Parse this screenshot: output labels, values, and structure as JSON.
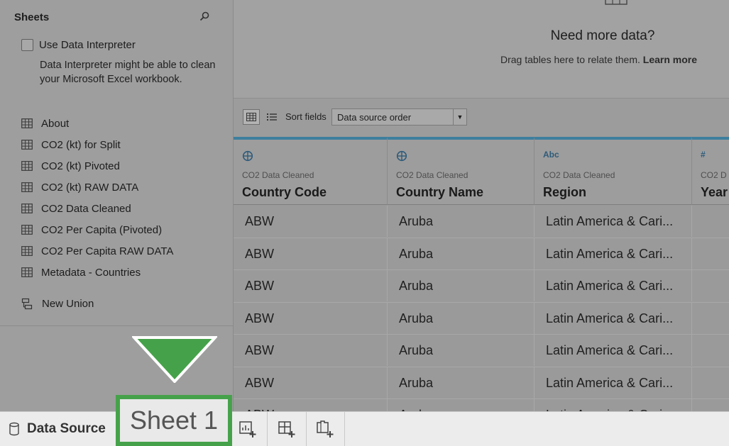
{
  "sidebar": {
    "title": "Sheets",
    "search_icon": "search-icon",
    "interpreter": {
      "label": "Use Data Interpreter",
      "checked": false,
      "description": "Data Interpreter might be able to clean your Microsoft Excel workbook."
    },
    "sheets": [
      {
        "label": "About"
      },
      {
        "label": "CO2 (kt) for Split"
      },
      {
        "label": "CO2 (kt) Pivoted"
      },
      {
        "label": "CO2 (kt) RAW DATA"
      },
      {
        "label": "CO2 Data Cleaned"
      },
      {
        "label": "CO2 Per Capita (Pivoted)"
      },
      {
        "label": "CO2 Per Capita RAW DATA"
      },
      {
        "label": "Metadata - Countries"
      }
    ],
    "new_union": "New Union"
  },
  "canvas": {
    "heading": "Need more data?",
    "hint": "Drag tables here to relate them.",
    "learn_more": "Learn more"
  },
  "toolbar": {
    "sort_label": "Sort fields",
    "sort_value": "Data source order"
  },
  "grid": {
    "columns": [
      {
        "type_icon": "globe-icon",
        "type_text": "",
        "source": "CO2 Data Cleaned",
        "name": "Country Code"
      },
      {
        "type_icon": "globe-icon",
        "type_text": "",
        "source": "CO2 Data Cleaned",
        "name": "Country Name"
      },
      {
        "type_icon": "",
        "type_text": "Abc",
        "source": "CO2 Data Cleaned",
        "name": "Region"
      },
      {
        "type_icon": "",
        "type_text": "#",
        "source": "CO2 D",
        "name": "Year"
      }
    ],
    "rows": [
      [
        "ABW",
        "Aruba",
        "Latin America & Cari..."
      ],
      [
        "ABW",
        "Aruba",
        "Latin America & Cari..."
      ],
      [
        "ABW",
        "Aruba",
        "Latin America & Cari..."
      ],
      [
        "ABW",
        "Aruba",
        "Latin America & Cari..."
      ],
      [
        "ABW",
        "Aruba",
        "Latin America & Cari..."
      ],
      [
        "ABW",
        "Aruba",
        "Latin America & Cari..."
      ],
      [
        "ABW",
        "Aruba",
        "Latin America & Cari..."
      ]
    ]
  },
  "tabs": {
    "data_source": "Data Source",
    "sheet1": "Sheet 1"
  },
  "colors": {
    "highlight": "#46a24a",
    "column_accent": "#3e7f9e"
  }
}
